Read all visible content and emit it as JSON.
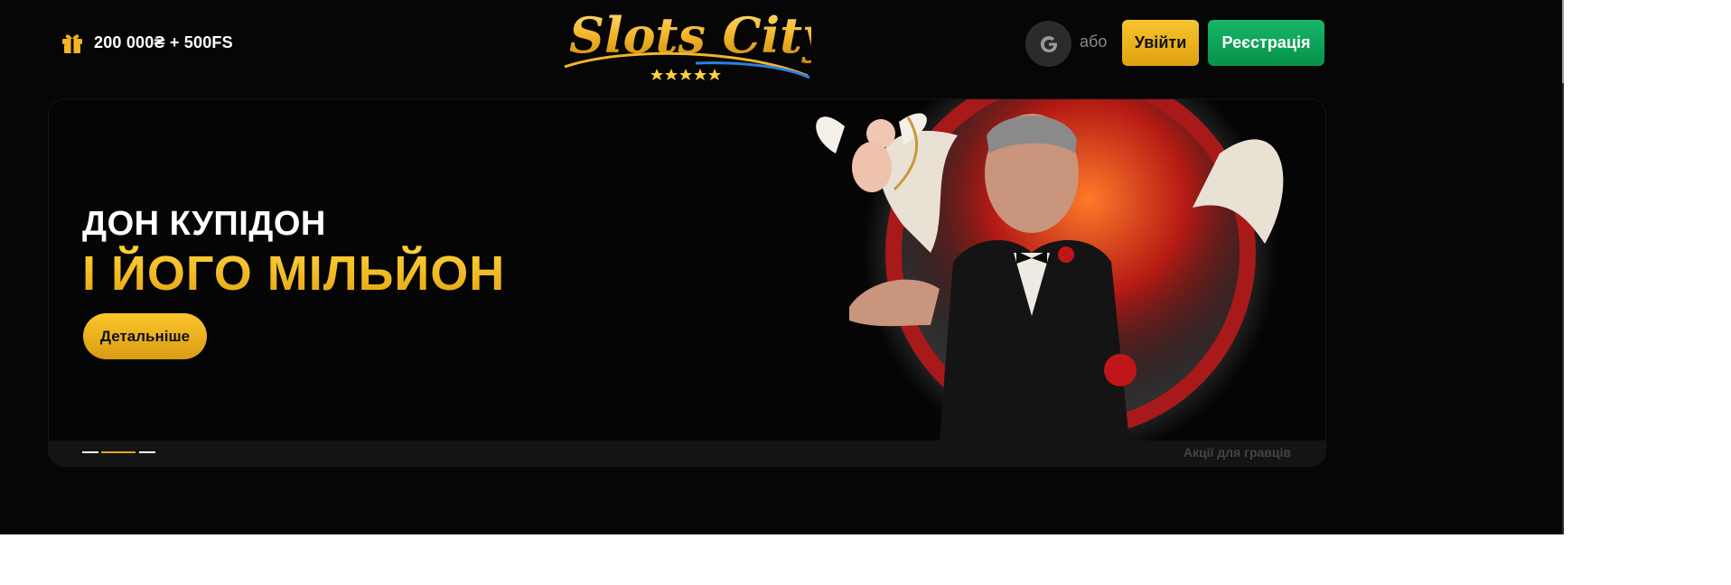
{
  "header": {
    "bonus_icon": "gift-icon",
    "bonus_text": "200 000₴ + 500FS",
    "logo_text": "Slots City",
    "logo_stars": 5,
    "google_icon": "google-icon",
    "or_text": "або",
    "login_label": "Увійти",
    "register_label": "Реєстрація"
  },
  "banner": {
    "headline_line1": "ДОН КУПІДОН",
    "headline_line2": "І ЙОГО МІЛЬЙОН",
    "details_label": "Детальніше",
    "slides": [
      {
        "active": false
      },
      {
        "active": true
      },
      {
        "active": false
      }
    ],
    "promo_link": "Акції для гравців",
    "image_icon": "godfather-cupid-illustration"
  },
  "colors": {
    "background": "#060607",
    "accent_gold": "#f0b91f",
    "register_green": "#0ea55c",
    "page_white": "#ffffff"
  }
}
